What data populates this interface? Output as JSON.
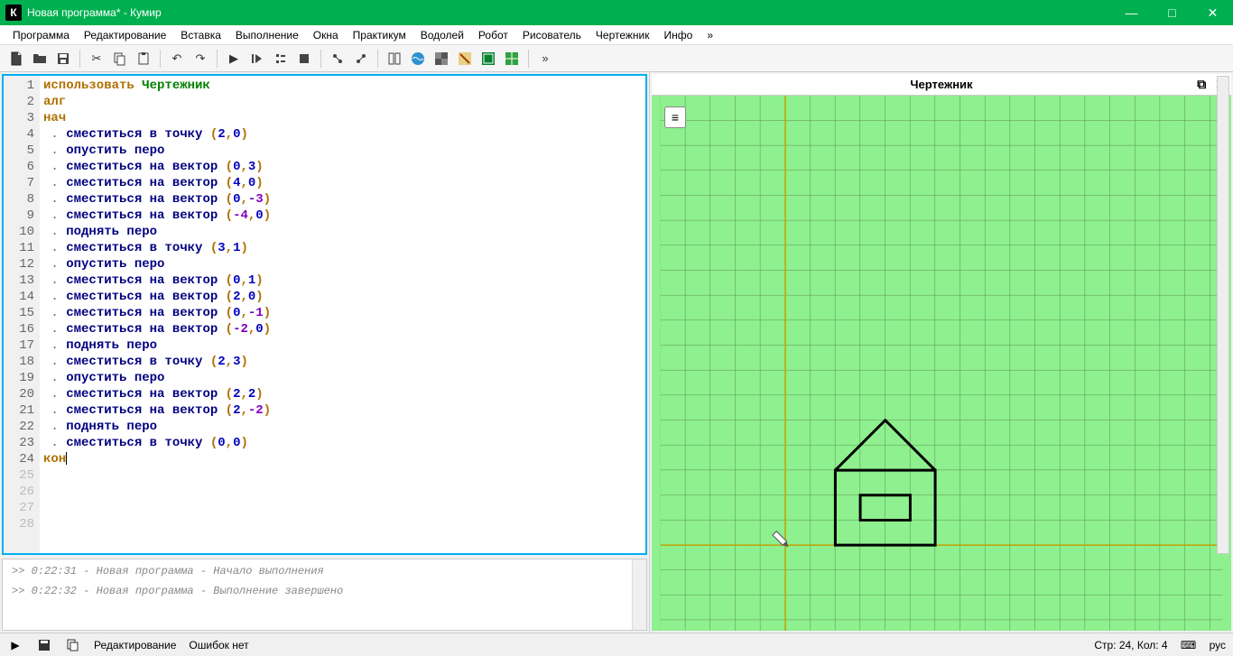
{
  "window": {
    "title": "Новая программа* - Кумир",
    "app_letter": "К"
  },
  "menu": [
    "Программа",
    "Редактирование",
    "Вставка",
    "Выполнение",
    "Окна",
    "Практикум",
    "Водолей",
    "Робот",
    "Рисователь",
    "Чертежник",
    "Инфо",
    "»"
  ],
  "right_panel": {
    "title": "Чертежник"
  },
  "code": {
    "lines": [
      [
        {
          "t": "использовать ",
          "c": "kw-use"
        },
        {
          "t": "Чертежник",
          "c": "kw-mod"
        }
      ],
      [
        {
          "t": "алг",
          "c": "kw-alg"
        }
      ],
      [
        {
          "t": "нач",
          "c": "kw-alg"
        }
      ],
      [
        {
          "t": ". ",
          "c": "dot"
        },
        {
          "t": "сместиться в точку ",
          "c": "kw-cmd"
        },
        {
          "t": "(",
          "c": "punct"
        },
        {
          "t": "2",
          "c": "num"
        },
        {
          "t": ",",
          "c": "punct"
        },
        {
          "t": "0",
          "c": "num"
        },
        {
          "t": ")",
          "c": "punct"
        }
      ],
      [
        {
          "t": ". ",
          "c": "dot"
        },
        {
          "t": "опустить перо",
          "c": "kw-cmd"
        }
      ],
      [
        {
          "t": ". ",
          "c": "dot"
        },
        {
          "t": "сместиться на вектор ",
          "c": "kw-cmd"
        },
        {
          "t": "(",
          "c": "punct"
        },
        {
          "t": "0",
          "c": "num"
        },
        {
          "t": ",",
          "c": "punct"
        },
        {
          "t": "3",
          "c": "num"
        },
        {
          "t": ")",
          "c": "punct"
        }
      ],
      [
        {
          "t": ". ",
          "c": "dot"
        },
        {
          "t": "сместиться на вектор ",
          "c": "kw-cmd"
        },
        {
          "t": "(",
          "c": "punct"
        },
        {
          "t": "4",
          "c": "num"
        },
        {
          "t": ",",
          "c": "punct"
        },
        {
          "t": "0",
          "c": "num"
        },
        {
          "t": ")",
          "c": "punct"
        }
      ],
      [
        {
          "t": ". ",
          "c": "dot"
        },
        {
          "t": "сместиться на вектор ",
          "c": "kw-cmd"
        },
        {
          "t": "(",
          "c": "punct"
        },
        {
          "t": "0",
          "c": "num"
        },
        {
          "t": ",",
          "c": "punct"
        },
        {
          "t": "-3",
          "c": "neg"
        },
        {
          "t": ")",
          "c": "punct"
        }
      ],
      [
        {
          "t": ". ",
          "c": "dot"
        },
        {
          "t": "сместиться на вектор ",
          "c": "kw-cmd"
        },
        {
          "t": "(",
          "c": "punct"
        },
        {
          "t": "-4",
          "c": "neg"
        },
        {
          "t": ",",
          "c": "punct"
        },
        {
          "t": "0",
          "c": "num"
        },
        {
          "t": ")",
          "c": "punct"
        }
      ],
      [
        {
          "t": ". ",
          "c": "dot"
        },
        {
          "t": "поднять перо",
          "c": "kw-cmd"
        }
      ],
      [
        {
          "t": ". ",
          "c": "dot"
        },
        {
          "t": "сместиться в точку ",
          "c": "kw-cmd"
        },
        {
          "t": "(",
          "c": "punct"
        },
        {
          "t": "3",
          "c": "num"
        },
        {
          "t": ",",
          "c": "punct"
        },
        {
          "t": "1",
          "c": "num"
        },
        {
          "t": ")",
          "c": "punct"
        }
      ],
      [
        {
          "t": ". ",
          "c": "dot"
        },
        {
          "t": "опустить перо",
          "c": "kw-cmd"
        }
      ],
      [
        {
          "t": ". ",
          "c": "dot"
        },
        {
          "t": "сместиться на вектор ",
          "c": "kw-cmd"
        },
        {
          "t": "(",
          "c": "punct"
        },
        {
          "t": "0",
          "c": "num"
        },
        {
          "t": ",",
          "c": "punct"
        },
        {
          "t": "1",
          "c": "num"
        },
        {
          "t": ")",
          "c": "punct"
        }
      ],
      [
        {
          "t": ". ",
          "c": "dot"
        },
        {
          "t": "сместиться на вектор ",
          "c": "kw-cmd"
        },
        {
          "t": "(",
          "c": "punct"
        },
        {
          "t": "2",
          "c": "num"
        },
        {
          "t": ",",
          "c": "punct"
        },
        {
          "t": "0",
          "c": "num"
        },
        {
          "t": ")",
          "c": "punct"
        }
      ],
      [
        {
          "t": ". ",
          "c": "dot"
        },
        {
          "t": "сместиться на вектор ",
          "c": "kw-cmd"
        },
        {
          "t": "(",
          "c": "punct"
        },
        {
          "t": "0",
          "c": "num"
        },
        {
          "t": ",",
          "c": "punct"
        },
        {
          "t": "-1",
          "c": "neg"
        },
        {
          "t": ")",
          "c": "punct"
        }
      ],
      [
        {
          "t": ". ",
          "c": "dot"
        },
        {
          "t": "сместиться на вектор ",
          "c": "kw-cmd"
        },
        {
          "t": "(",
          "c": "punct"
        },
        {
          "t": "-2",
          "c": "neg"
        },
        {
          "t": ",",
          "c": "punct"
        },
        {
          "t": "0",
          "c": "num"
        },
        {
          "t": ")",
          "c": "punct"
        }
      ],
      [
        {
          "t": ". ",
          "c": "dot"
        },
        {
          "t": "поднять перо",
          "c": "kw-cmd"
        }
      ],
      [
        {
          "t": ". ",
          "c": "dot"
        },
        {
          "t": "сместиться в точку ",
          "c": "kw-cmd"
        },
        {
          "t": "(",
          "c": "punct"
        },
        {
          "t": "2",
          "c": "num"
        },
        {
          "t": ",",
          "c": "punct"
        },
        {
          "t": "3",
          "c": "num"
        },
        {
          "t": ")",
          "c": "punct"
        }
      ],
      [
        {
          "t": ". ",
          "c": "dot"
        },
        {
          "t": "опустить перо",
          "c": "kw-cmd"
        }
      ],
      [
        {
          "t": ". ",
          "c": "dot"
        },
        {
          "t": "сместиться на вектор ",
          "c": "kw-cmd"
        },
        {
          "t": "(",
          "c": "punct"
        },
        {
          "t": "2",
          "c": "num"
        },
        {
          "t": ",",
          "c": "punct"
        },
        {
          "t": "2",
          "c": "num"
        },
        {
          "t": ")",
          "c": "punct"
        }
      ],
      [
        {
          "t": ". ",
          "c": "dot"
        },
        {
          "t": "сместиться на вектор ",
          "c": "kw-cmd"
        },
        {
          "t": "(",
          "c": "punct"
        },
        {
          "t": "2",
          "c": "num"
        },
        {
          "t": ",",
          "c": "punct"
        },
        {
          "t": "-2",
          "c": "neg"
        },
        {
          "t": ")",
          "c": "punct"
        }
      ],
      [
        {
          "t": ". ",
          "c": "dot"
        },
        {
          "t": "поднять перо",
          "c": "kw-cmd"
        }
      ],
      [
        {
          "t": ". ",
          "c": "dot"
        },
        {
          "t": "сместиться в точку ",
          "c": "kw-cmd"
        },
        {
          "t": "(",
          "c": "punct"
        },
        {
          "t": "0",
          "c": "num"
        },
        {
          "t": ",",
          "c": "punct"
        },
        {
          "t": "0",
          "c": "num"
        },
        {
          "t": ")",
          "c": "punct"
        }
      ],
      [
        {
          "t": "кон",
          "c": "kw-alg"
        },
        {
          "t": "|",
          "c": "caret"
        }
      ]
    ],
    "extra_lines": [
      25,
      26,
      27,
      28
    ]
  },
  "log": [
    ">>  0:22:31 - Новая программа - Начало выполнения",
    ">>  0:22:32 - Новая программа - Выполнение завершено"
  ],
  "status": {
    "mode": "Редактирование",
    "errors": "Ошибок нет",
    "pos": "Стр: 24, Кол: 4",
    "lang": "рус"
  }
}
